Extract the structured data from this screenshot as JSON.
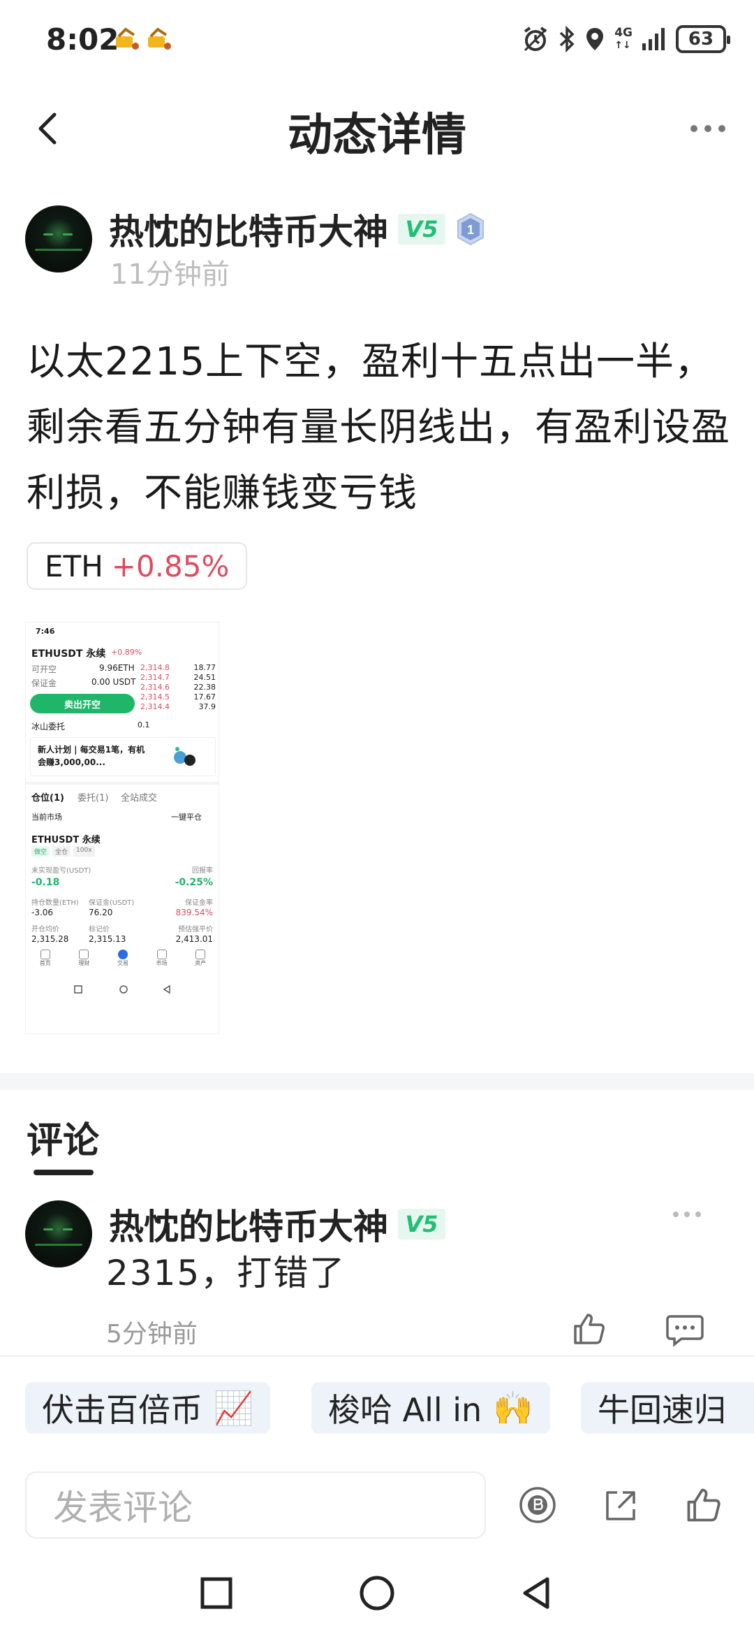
{
  "status_bar": {
    "time": "8:02",
    "network": "4G",
    "battery": "63"
  },
  "nav": {
    "title": "动态详情"
  },
  "post": {
    "author": "热忱的比特币大神",
    "vip_badge": "V5",
    "level_badge": "1",
    "time": "11分钟前",
    "text": "以太2215上下空，盈利十五点出一半，剩余看五分钟有量长阴线出，有盈利设盈利损，不能赚钱变亏钱",
    "tag": {
      "symbol": "ETH",
      "change": "+0.85%"
    },
    "screenshot": {
      "time": "7:46",
      "pair": "ETHUSDT 永续",
      "pair_change": "+0.89%",
      "row1_label": "可开空",
      "row1_value": "9.96ETH",
      "margin_label": "保证金",
      "margin_value": "0.00 USDT",
      "sell_button": "卖出开空",
      "iceberg": "冰山委托",
      "qty": "0.1",
      "orderbook": [
        {
          "price": "2,314.8",
          "qty": "18.77"
        },
        {
          "price": "2,314.7",
          "qty": "24.51"
        },
        {
          "price": "2,314.6",
          "qty": "22.38"
        },
        {
          "price": "2,314.5",
          "qty": "17.67"
        },
        {
          "price": "2,314.4",
          "qty": "37.9"
        }
      ],
      "promo_text": "新人计划 | 每交易1笔，有机会赚3,000,00...",
      "tab_positions": "仓位(1)",
      "tab_orders": "委托(1)",
      "tab_all": "全站成交",
      "current_market": "当前市场",
      "close_all": "一键平仓",
      "position_pair": "ETHUSDT 永续",
      "pos_tags": [
        "做空",
        "全仓",
        "100x"
      ],
      "unrealized_label": "未实现盈亏(USDT)",
      "unrealized_value": "-0.18",
      "return_label": "回报率",
      "return_value": "-0.25%",
      "size_label": "持仓数量(ETH)",
      "size_value": "-3.06",
      "margin2_label": "保证金(USDT)",
      "margin2_value": "76.20",
      "margin_rate_label": "保证金率",
      "margin_rate_value": "839.54%",
      "entry_label": "开仓均价",
      "entry_value": "2,315.28",
      "mark_label": "标记价",
      "mark_value": "2,315.13",
      "liq_label": "预估强平价",
      "liq_value": "2,413.01",
      "bottom_tabs": [
        "首页",
        "理财",
        "交易",
        "市场",
        "资产"
      ]
    }
  },
  "comments": {
    "title": "评论",
    "items": [
      {
        "author": "热忱的比特币大神",
        "vip_badge": "V5",
        "text": "2315，打错了",
        "time": "5分钟前"
      }
    ]
  },
  "quick_chips": [
    {
      "label": "伏击百倍币",
      "emoji": "📈"
    },
    {
      "label": "梭哈 All in",
      "emoji": "🙌"
    },
    {
      "label": "牛回速归",
      "emoji": ""
    }
  ],
  "compose": {
    "placeholder": "发表评论"
  }
}
